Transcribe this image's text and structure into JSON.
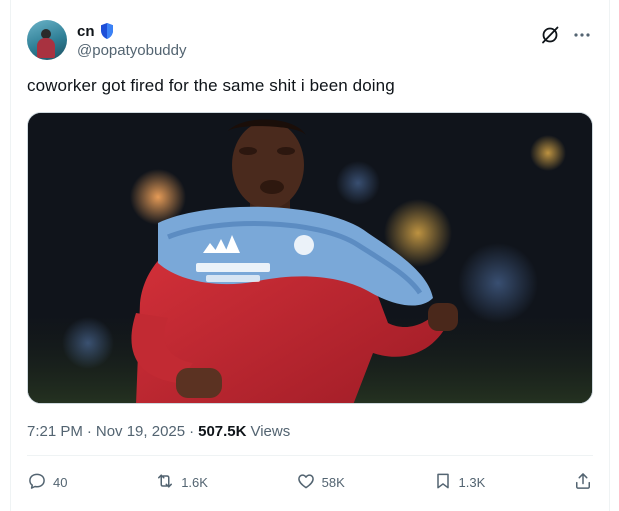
{
  "colors": {
    "text_primary": "#0f1419",
    "text_secondary": "#536471",
    "verified_badge": "#1d4ed8",
    "border": "#eff3f4"
  },
  "author": {
    "display_name": "cn",
    "handle": "@popatyobuddy",
    "verified_icon": "shield-badge-icon",
    "avatar_icon": "avatar"
  },
  "tweet": {
    "text": "coworker got fired for the same shit i been doing"
  },
  "meta": {
    "time": "7:21 PM",
    "sep1": "·",
    "date": "Nov 19, 2025",
    "sep2": "·",
    "views_count": "507.5K",
    "views_label": "Views"
  },
  "actions": {
    "reply": {
      "icon": "reply-icon",
      "count": "40"
    },
    "repost": {
      "icon": "repost-icon",
      "count": "1.6K"
    },
    "like": {
      "icon": "heart-icon",
      "count": "58K"
    },
    "bookmark": {
      "icon": "bookmark-icon",
      "count": "1.3K"
    },
    "share": {
      "icon": "share-icon"
    }
  },
  "top_actions": {
    "grok": "grok-icon",
    "more": "more-icon"
  }
}
